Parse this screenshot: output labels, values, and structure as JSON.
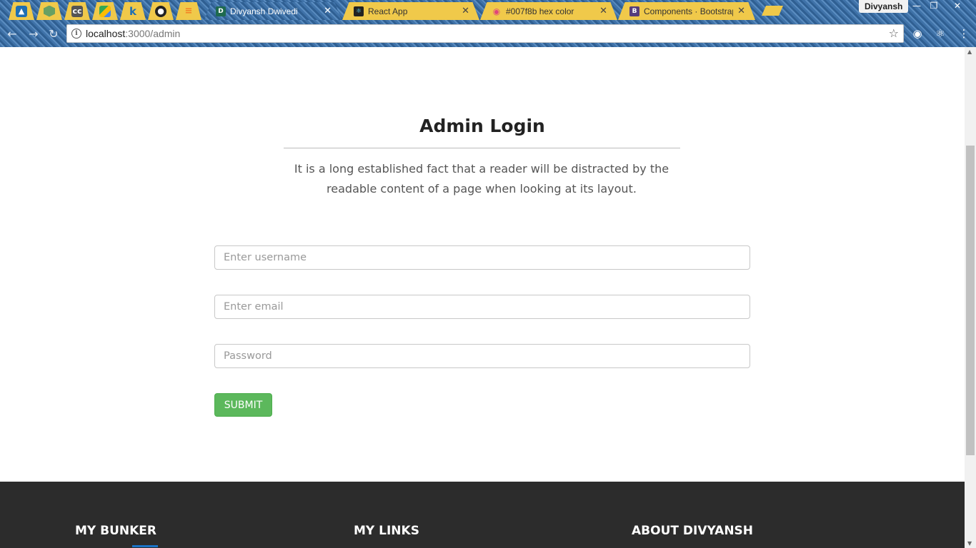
{
  "browser": {
    "pinned_tabs": [
      {
        "icon": "bird-icon",
        "color": "#1f6fb3"
      },
      {
        "icon": "nodejs-icon",
        "color": "#68a063"
      },
      {
        "icon": "cc-icon",
        "color": "#555555"
      },
      {
        "icon": "maps-icon",
        "color": "#34a853"
      },
      {
        "icon": "k-icon",
        "color": "#1f6fb3"
      },
      {
        "icon": "github-icon",
        "color": "#222222"
      },
      {
        "icon": "stackoverflow-icon",
        "color": "#f48024"
      }
    ],
    "tabs": [
      {
        "title": "Divyansh Dwivedi",
        "icon_letter": "D",
        "active": true
      },
      {
        "title": "React App",
        "icon_letter": "⚛",
        "active": false
      },
      {
        "title": "#007f8b hex color",
        "icon_letter": "◉",
        "active": false
      },
      {
        "title": "Components · Bootstrap",
        "icon_letter": "B",
        "active": false
      }
    ],
    "profile_name": "Divyansh",
    "url_host": "localhost",
    "url_path": ":3000/admin"
  },
  "login": {
    "title": "Admin Login",
    "description": "It is a long established fact that a reader will be distracted by the readable content of a page when looking at its layout.",
    "username_placeholder": "Enter username",
    "email_placeholder": "Enter email",
    "password_placeholder": "Password",
    "submit_label": "SUBMIT"
  },
  "footer": {
    "col1_title": "MY BUNKER",
    "col2_title": "MY LINKS",
    "col3_title": "ABOUT DIVYANSH"
  },
  "colors": {
    "submit": "#5cb85c",
    "footer_bg": "#2c2c2c",
    "tab_bg": "#f0c94a"
  }
}
